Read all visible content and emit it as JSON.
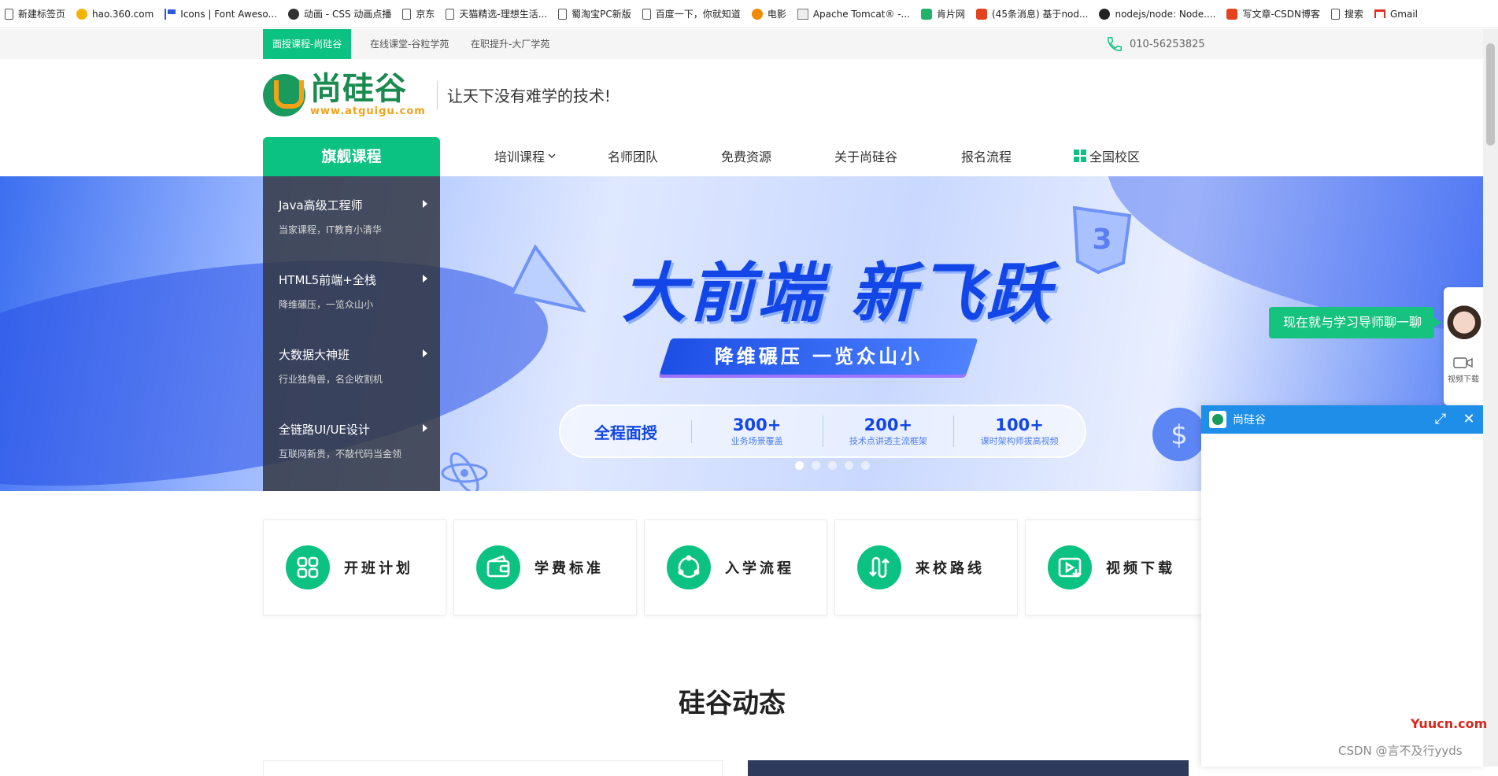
{
  "bookmarks": [
    {
      "label": "新建标签页",
      "icon": "page-icon"
    },
    {
      "label": "hao.360.com",
      "icon": "360-icon"
    },
    {
      "label": "Icons | Font Aweso...",
      "icon": "flag-icon"
    },
    {
      "label": "动画 - CSS 动画点播",
      "icon": "a-icon"
    },
    {
      "label": "京东",
      "icon": "page-icon"
    },
    {
      "label": "天猫精选-理想生活...",
      "icon": "page-icon"
    },
    {
      "label": "蜀淘宝PC新版",
      "icon": "page-icon"
    },
    {
      "label": "百度一下，你就知道",
      "icon": "page-icon"
    },
    {
      "label": "电影",
      "icon": "movie-icon"
    },
    {
      "label": "Apache Tomcat® -...",
      "icon": "tomcat-icon"
    },
    {
      "label": "肯片网",
      "icon": "q-icon"
    },
    {
      "label": "(45条消息) 基于nod...",
      "icon": "csdn-icon"
    },
    {
      "label": "nodejs/node: Node....",
      "icon": "github-icon"
    },
    {
      "label": "写文章-CSDN博客",
      "icon": "csdn-icon"
    },
    {
      "label": "搜索",
      "icon": "page-icon"
    },
    {
      "label": "Gmail",
      "icon": "gmail-icon"
    }
  ],
  "topstrip": {
    "links": [
      "面授课程-尚硅谷",
      "在线课堂-谷粒学苑",
      "在职提升-大厂学苑"
    ],
    "phone": "010-56253825"
  },
  "header": {
    "logo_cn": "尚硅谷",
    "logo_url": "www.atguigu.com",
    "slogan": "让天下没有难学的技术!"
  },
  "nav": {
    "flagship": "旗舰课程",
    "items": [
      "培训课程",
      "名师团队",
      "免费资源",
      "关于尚硅谷",
      "报名流程",
      "全国校区"
    ]
  },
  "sidebar": [
    {
      "title": "Java高级工程师",
      "desc": "当家课程，IT教育小清华"
    },
    {
      "title": "HTML5前端+全栈",
      "desc": "降维碾压，一览众山小"
    },
    {
      "title": "大数据大神班",
      "desc": "行业独角兽，名企收割机"
    },
    {
      "title": "全链路UI/UE设计",
      "desc": "互联网新贵，不敲代码当金领"
    }
  ],
  "banner": {
    "title": "大前端 新飞跃",
    "subtitle": "降维碾压  一览众山小",
    "stats": [
      {
        "num": "全程面授",
        "lbl": ""
      },
      {
        "num": "300+",
        "lbl": "业务场景覆盖"
      },
      {
        "num": "200+",
        "lbl": "技术点讲透主流框架"
      },
      {
        "num": "100+",
        "lbl": "课时架构师拔高视频"
      }
    ],
    "slide_count": 5,
    "active_slide": 1
  },
  "quicklinks": [
    {
      "label": "开班计划",
      "icon": "grid-icon"
    },
    {
      "label": "学费标准",
      "icon": "wallet-icon"
    },
    {
      "label": "入学流程",
      "icon": "cycle-icon"
    },
    {
      "label": "来校路线",
      "icon": "route-icon"
    },
    {
      "label": "视频下载",
      "icon": "video-download-icon"
    }
  ],
  "section_title": "硅谷动态",
  "chat": {
    "tab": "现在就与学习导师聊一聊",
    "rail_video": "视频下载",
    "window_title": "尚硅谷"
  },
  "watermark": "CSDN @言不及行yyds",
  "site_mark": "Yuucn.com",
  "colors": {
    "brand_green": "#0cc283",
    "chat_blue": "#1e8ee8",
    "banner_blue": "#1346e6"
  }
}
